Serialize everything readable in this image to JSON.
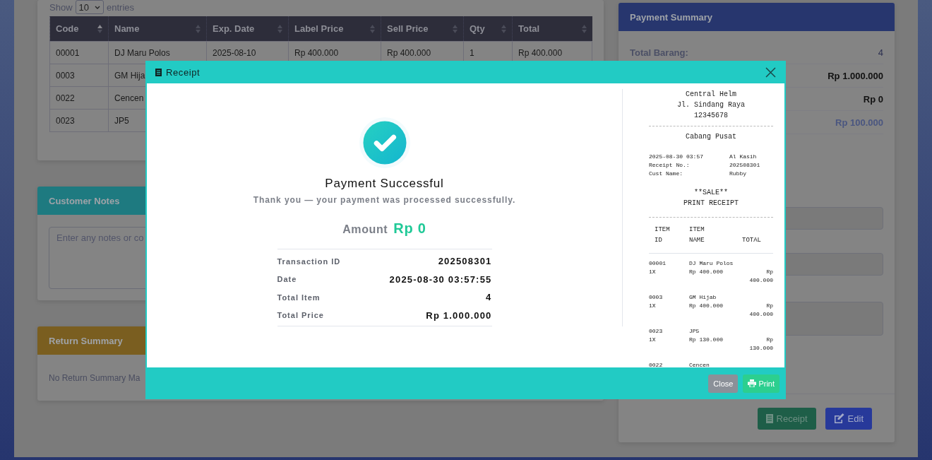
{
  "data_table": {
    "show_label": "Show",
    "length_value": "10",
    "entries_label": "entries",
    "columns": [
      {
        "label": "Code",
        "sorted": true
      },
      {
        "label": "Name",
        "sorted": false
      },
      {
        "label": "Exp. Date",
        "sorted": false
      },
      {
        "label": "Label Price",
        "sorted": false
      },
      {
        "label": "Sell Price",
        "sorted": false
      },
      {
        "label": "Qty",
        "sorted": false
      },
      {
        "label": "Total",
        "sorted": false
      }
    ],
    "rows": [
      [
        "00001",
        "DJ Maru Polos",
        "2025-08-10",
        "Rp 400.000",
        "Rp 400.000",
        "1",
        "Rp 400.000"
      ],
      [
        "0003",
        "GM Hija"
      ],
      [
        "0022",
        "Cencen"
      ],
      [
        "0023",
        "JP5"
      ]
    ]
  },
  "customer_notes": {
    "title": "Customer Notes",
    "placeholder": "Enter any notes or co"
  },
  "return_summary": {
    "title": "Return Summary",
    "text": "No Return Summary Ma"
  },
  "payment_summary": {
    "title": "Payment Summary",
    "rows": [
      {
        "label": "Total Barang:",
        "value": "4",
        "kind": "plain"
      },
      {
        "value": "Rp 1.000.000",
        "kind": "bold"
      },
      {
        "value": "Rp 0",
        "kind": "bold"
      },
      {
        "value": "Rp 100.000",
        "kind": "muted"
      }
    ],
    "fields": [
      {
        "kind": "input"
      },
      {
        "kind": "input"
      },
      {
        "kind": "textarea"
      }
    ],
    "buttons": [
      {
        "label": "Receipt",
        "kind": "receipt"
      },
      {
        "label": "Edit",
        "kind": "edit"
      }
    ]
  },
  "modal": {
    "title": "Receipt",
    "status": "Payment Successful",
    "message": "Thank you — your payment was processed successfully.",
    "amount_label": "Amount",
    "amount": "Rp 0",
    "details": [
      {
        "label": "Transaction ID",
        "value": "202508301"
      },
      {
        "label": "Date",
        "value": "2025-08-30 03:57:55"
      },
      {
        "label": "Total Item",
        "value": "4"
      },
      {
        "label": "Total Price",
        "value": "Rp 1.000.000"
      }
    ],
    "receipt": {
      "header": [
        "Central Helm",
        "Jl. Sindang Raya",
        "12345678"
      ],
      "branch": "Cabang Pusat",
      "meta": [
        {
          "label": "2025-08-30",
          "middle": "03:57",
          "value": "Al Kasih"
        },
        {
          "label": "Receipt No.:",
          "value": "202508301"
        },
        {
          "label": "Cust Name:",
          "value": "Rubby"
        }
      ],
      "sale": "**SALE**",
      "print_title": "PRINT RECEIPT",
      "columns": [
        "ITEM ID",
        "ITEM NAME",
        "TOTAL"
      ],
      "items": [
        {
          "id": "00001",
          "name": "DJ Maru Polos",
          "qty": "1X",
          "price": "Rp 400.000",
          "total": "Rp 400.000"
        },
        {
          "id": "0003",
          "name": "GM Hijab",
          "qty": "1X",
          "price": "Rp 400.000",
          "total": "Rp 400.000"
        },
        {
          "id": "0023",
          "name": "JP5",
          "qty": "1X",
          "price": "Rp 130.000",
          "total": "Rp 130.000"
        },
        {
          "id": "0022",
          "name": "Cencen"
        }
      ]
    },
    "buttons": [
      {
        "label": "Close",
        "kind": "secondary"
      },
      {
        "label": "Print",
        "kind": "success"
      }
    ]
  }
}
